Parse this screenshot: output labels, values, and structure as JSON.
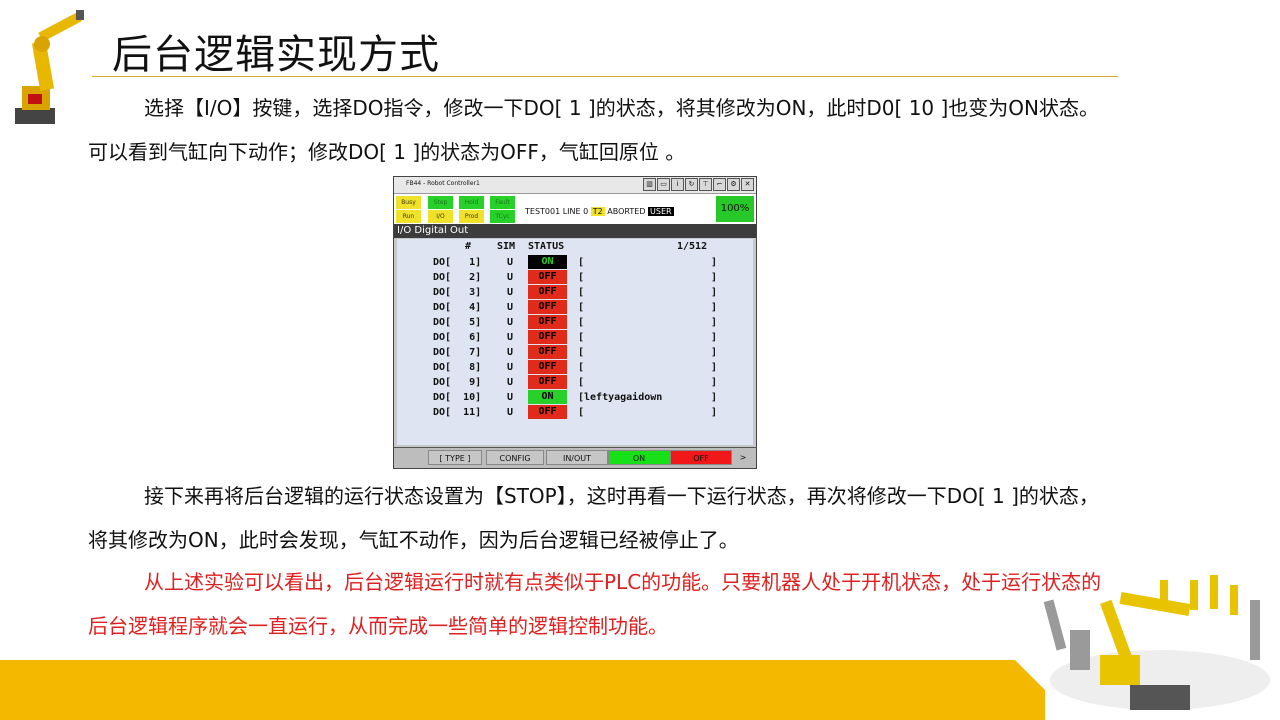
{
  "slide": {
    "title": "后台逻辑实现方式",
    "para1": "选择【I/O】按键，选择DO指令，修改一下DO[ 1 ]的状态，将其修改为ON，此时D0[ 10 ]也变为ON状态。可以看到气缸向下动作；修改DO[ 1 ]的状态为OFF，气缸回原位 。",
    "para2": "接下来再将后台逻辑的运行状态设置为【STOP】，这时再看一下运行状态，再次将修改一下DO[ 1 ]的状态，将其修改为ON，此时会发现，气缸不动作，因为后台逻辑已经被停止了。",
    "para3": "从上述实验可以看出，后台逻辑运行时就有点类似于PLC的功能。只要机器人处于开机状态，处于运行状态的后台逻辑程序就会一直运行，从而完成一些简单的逻辑控制功能。"
  },
  "tp": {
    "window_title": "FB44 - Robot Controller1",
    "leds": [
      "Busy",
      "Step",
      "Hold",
      "Fault",
      "Run",
      "I/O",
      "Prod",
      "TCyc"
    ],
    "status_program": "TEST001 LINE 0",
    "status_mode": "T2",
    "status_state": "ABORTED",
    "status_user": "USER",
    "override": "100%",
    "screen_title": "I/O Digital Out",
    "header": {
      "num": "#",
      "sim": "SIM",
      "status": "STATUS",
      "page": "1/512"
    },
    "rows": [
      {
        "label": "DO[   1]",
        "sim": "U",
        "status": "ON",
        "comment": "["
      },
      {
        "label": "DO[   2]",
        "sim": "U",
        "status": "OFF",
        "comment": "["
      },
      {
        "label": "DO[   3]",
        "sim": "U",
        "status": "OFF",
        "comment": "["
      },
      {
        "label": "DO[   4]",
        "sim": "U",
        "status": "OFF",
        "comment": "["
      },
      {
        "label": "DO[   5]",
        "sim": "U",
        "status": "OFF",
        "comment": "["
      },
      {
        "label": "DO[   6]",
        "sim": "U",
        "status": "OFF",
        "comment": "["
      },
      {
        "label": "DO[   7]",
        "sim": "U",
        "status": "OFF",
        "comment": "["
      },
      {
        "label": "DO[   8]",
        "sim": "U",
        "status": "OFF",
        "comment": "["
      },
      {
        "label": "DO[   9]",
        "sim": "U",
        "status": "OFF",
        "comment": "["
      },
      {
        "label": "DO[  10]",
        "sim": "U",
        "status": "ON",
        "comment": "[leftyagaidown"
      },
      {
        "label": "DO[  11]",
        "sim": "U",
        "status": "OFF",
        "comment": "["
      }
    ],
    "row_close": "]",
    "fkeys": [
      "[ TYPE ]",
      "CONFIG",
      "IN/OUT",
      "ON",
      "OFF",
      ">"
    ]
  },
  "colors": {
    "accent": "#f5b800",
    "red_text": "#e02020",
    "led_yellow": "#f0e22a",
    "led_green": "#28d02a"
  }
}
